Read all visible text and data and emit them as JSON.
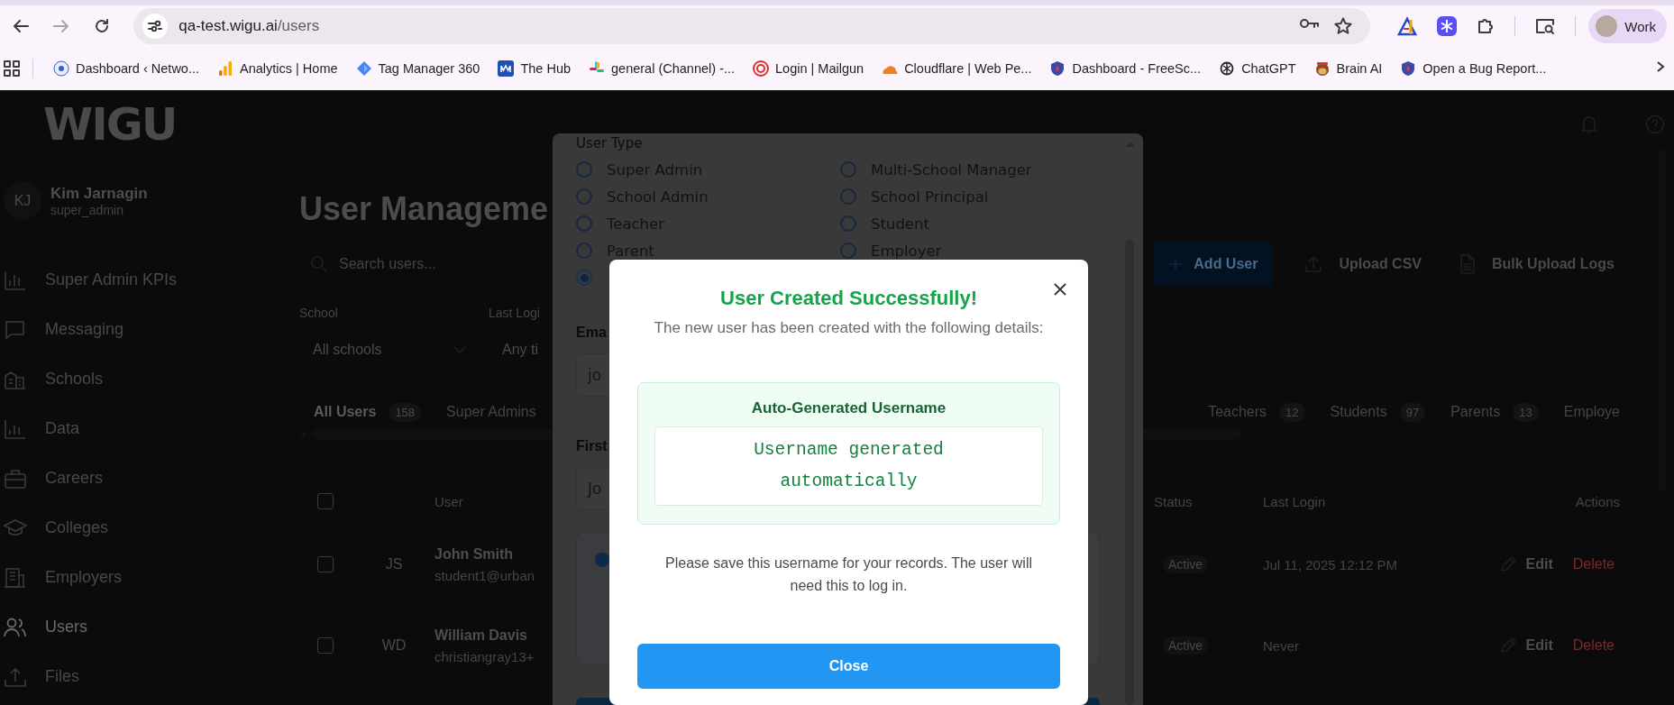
{
  "browser": {
    "url_domain": "qa-test.wigu.ai",
    "url_path": "/users",
    "profile": "Work",
    "bookmarks": [
      {
        "label": "Dashboard ‹ Netwo..."
      },
      {
        "label": "Analytics | Home"
      },
      {
        "label": "Tag Manager 360"
      },
      {
        "label": "The Hub"
      },
      {
        "label": "general (Channel) -..."
      },
      {
        "label": "Login | Mailgun"
      },
      {
        "label": "Cloudflare | Web Pe..."
      },
      {
        "label": "Dashboard - FreeSc..."
      },
      {
        "label": "ChatGPT"
      },
      {
        "label": "Brain AI"
      },
      {
        "label": "Open a Bug Report..."
      }
    ]
  },
  "app": {
    "logo": "WIGU",
    "user": {
      "initials": "KJ",
      "name": "Kim Jarnagin",
      "role": "super_admin"
    },
    "nav": [
      {
        "label": "Super Admin KPIs",
        "selected": false
      },
      {
        "label": "Messaging",
        "selected": false
      },
      {
        "label": "Schools",
        "selected": false
      },
      {
        "label": "Data",
        "selected": false
      },
      {
        "label": "Careers",
        "selected": false
      },
      {
        "label": "Colleges",
        "selected": false
      },
      {
        "label": "Employers",
        "selected": false
      },
      {
        "label": "Users",
        "selected": true
      },
      {
        "label": "Files",
        "selected": false
      }
    ],
    "title": "User Manageme",
    "search": {
      "placeholder": "Search users..."
    },
    "actions": {
      "add": "Add User",
      "upload": "Upload CSV",
      "logs": "Bulk Upload Logs"
    },
    "filters": [
      {
        "label": "School",
        "value": "All schools"
      },
      {
        "label": "Last Logi",
        "value": "Any ti"
      }
    ],
    "tabs": [
      {
        "label": "All Users",
        "count": "158",
        "selected": true
      },
      {
        "label": "Super Admins",
        "selected": false
      },
      {
        "label": "Teachers",
        "count": "12",
        "selected": false
      },
      {
        "label": "Students",
        "count": "97",
        "selected": false
      },
      {
        "label": "Parents",
        "count": "13",
        "selected": false
      },
      {
        "label": "Employe",
        "selected": false
      }
    ],
    "table": {
      "select_all_checked": false,
      "columns": [
        "User",
        "Status",
        "Last Login",
        "Actions"
      ],
      "rows": [
        {
          "checked": false,
          "initials": "JS",
          "name": "John Smith",
          "email": "student1@urban",
          "status": "Active",
          "last_login": "Jul 11, 2025 12:12 PM",
          "edit": "Edit",
          "delete": "Delete"
        },
        {
          "checked": false,
          "initials": "WD",
          "name": "William Davis",
          "email": "christiangray13+",
          "status": "Active",
          "last_login": "Never",
          "edit": "Edit",
          "delete": "Delete"
        }
      ]
    }
  },
  "form_dialog": {
    "section_label": "User Type",
    "user_types": [
      {
        "label": "Super Admin",
        "selected": false
      },
      {
        "label": "Multi-School Manager",
        "selected": false
      },
      {
        "label": "School Admin",
        "selected": false
      },
      {
        "label": "School Principal",
        "selected": false
      },
      {
        "label": "Teacher",
        "selected": false
      },
      {
        "label": "Student",
        "selected": false
      },
      {
        "label": "Parent",
        "selected": false
      },
      {
        "label": "Employer",
        "selected": false
      },
      {
        "selected": true
      }
    ],
    "fields": [
      {
        "label": "Ema",
        "placeholder": "jo"
      },
      {
        "label": "First",
        "placeholder": "Jo"
      }
    ]
  },
  "success_dialog": {
    "title": "User Created Successfully!",
    "subtitle": "The new user has been created with the following details:",
    "username_label": "Auto-Generated Username",
    "username": "Username generated automatically",
    "note": "Please save this username for your records. The user will need this to log in.",
    "close_button": "Close"
  }
}
